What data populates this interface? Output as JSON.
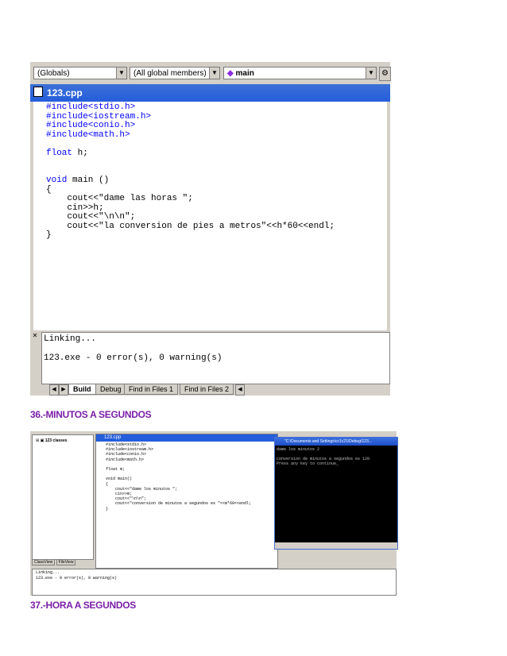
{
  "screen1": {
    "toolbar": {
      "scope": "(Globals)",
      "members": "(All global members)",
      "function": "main"
    },
    "editor": {
      "title": "123.cpp",
      "code": [
        {
          "k": true,
          "t": "#include<stdio.h>"
        },
        {
          "k": true,
          "t": "#include<iostream.h>"
        },
        {
          "k": true,
          "t": "#include<conio.h>"
        },
        {
          "k": true,
          "t": "#include<math.h>"
        },
        {
          "k": false,
          "t": ""
        },
        {
          "k": true,
          "t": "float h;",
          "kwLen": 5
        },
        {
          "k": false,
          "t": ""
        },
        {
          "k": false,
          "t": ""
        },
        {
          "k": true,
          "t": "void main ()",
          "kwLen": 4
        },
        {
          "k": false,
          "t": "{"
        },
        {
          "k": false,
          "t": "    cout<<\"dame las horas \";"
        },
        {
          "k": false,
          "t": "    cin>>h;"
        },
        {
          "k": false,
          "t": "    cout<<\"\\n\\n\";"
        },
        {
          "k": false,
          "t": "    cout<<\"la conversion de pies a metros\"<<h*60<<endl;"
        },
        {
          "k": false,
          "t": "}"
        }
      ]
    },
    "output": {
      "line1": "Linking...",
      "line2": "123.exe - 0 error(s), 0 warning(s)"
    },
    "tabs": {
      "build": "Build",
      "debug": "Debug",
      "find1": "Find in Files 1",
      "find2": "Find in Files 2"
    }
  },
  "heading36": "36.-MINUTOS A SEGUNDOS",
  "screen2": {
    "classview": {
      "root": "123 classes",
      "tab1": "ClassView",
      "tab2": "FileView"
    },
    "editor": {
      "title": "123.cpp",
      "code": "#include<stdio.h>\n#include<iostream.h>\n#include<conio.h>\n#include<math.h>\n\nfloat m;\n\nvoid main()\n{\n    cout<<\"dame los minutos \";\n    cin>>m;\n    cout<<\"\\n\\n\";\n    cout<<\"conversion de minutos a segundos es \"<<m*60<<endl;\n}"
    },
    "console": {
      "title": "\"C:\\Documents and Settings\\cc1c21\\Debug\\123...",
      "text": "dame los minutos 2\n\nconversion de minutos a segundos es 120\nPress any key to continue_"
    },
    "output": {
      "line1": "Linking...",
      "line2": "123.exe - 0 error(s), 0 warning(s)"
    }
  },
  "heading37": "37.-HORA A SEGUNDOS"
}
